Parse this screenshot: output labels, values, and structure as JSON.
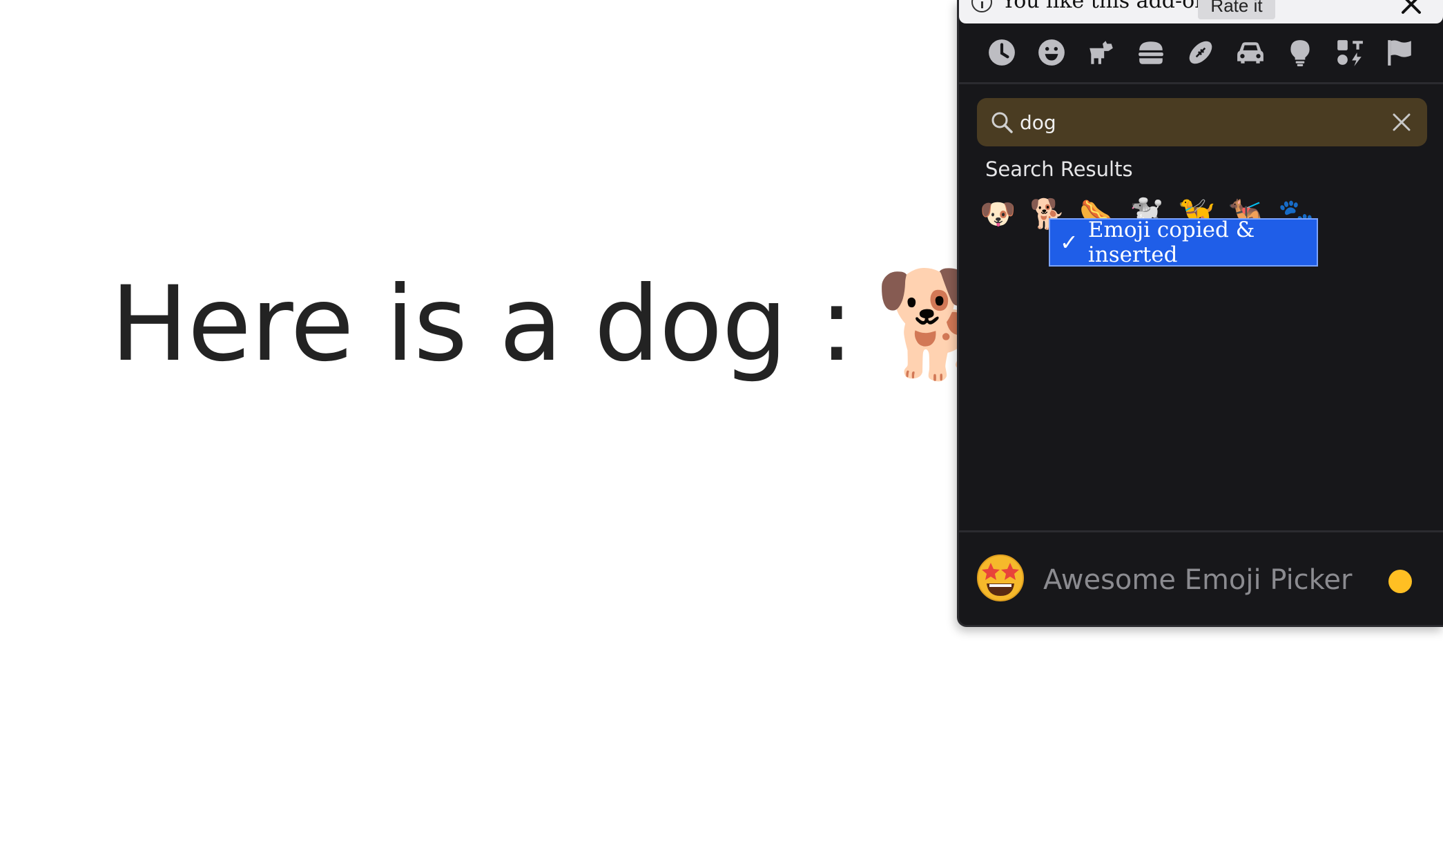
{
  "page": {
    "text": "Here is a dog :",
    "inserted_emoji": "🐕"
  },
  "notice": {
    "text": "You like this add-on?",
    "rate_label": "Rate it"
  },
  "categories": [
    {
      "name": "recent",
      "icon": "clock-icon"
    },
    {
      "name": "smileys",
      "icon": "smiley-icon"
    },
    {
      "name": "animals",
      "icon": "dog-icon"
    },
    {
      "name": "food",
      "icon": "burger-icon"
    },
    {
      "name": "activities",
      "icon": "football-icon"
    },
    {
      "name": "travel",
      "icon": "car-icon"
    },
    {
      "name": "objects",
      "icon": "lightbulb-icon"
    },
    {
      "name": "symbols",
      "icon": "symbols-icon"
    },
    {
      "name": "flags",
      "icon": "flag-icon"
    }
  ],
  "search": {
    "value": "dog",
    "results_title": "Search Results",
    "results": [
      "🐶",
      "🐕",
      "🌭",
      "🐩",
      "🦮",
      "🐕‍🦺",
      "🐾"
    ]
  },
  "toast": {
    "check": "✓",
    "text": "Emoji copied & inserted"
  },
  "footer": {
    "logo": "🤩",
    "app_name": "Awesome Emoji Picker",
    "skin_tone_color": "#ffbf23"
  },
  "colors": {
    "popup_bg": "#17171a",
    "search_bg": "#4a3c22",
    "toast_bg": "#1f5ee8",
    "icon_gray": "#bdbdc2"
  }
}
